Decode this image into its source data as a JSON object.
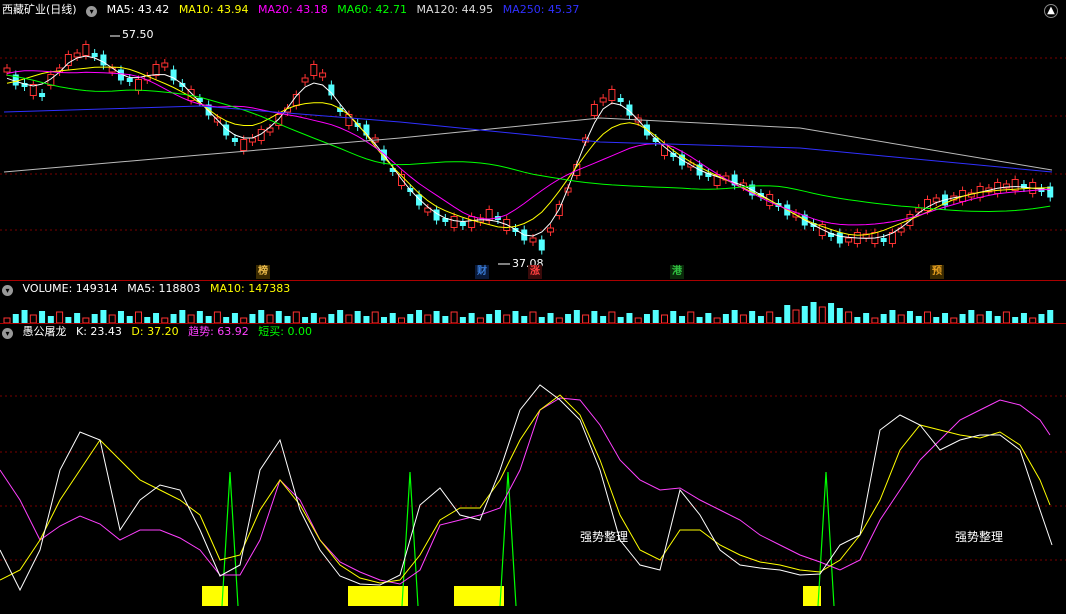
{
  "main": {
    "stock_name": "西藏矿业(日线)",
    "ma5_label": "MA5: 43.42",
    "ma10_label": "MA10: 43.94",
    "ma20_label": "MA20: 43.18",
    "ma60_label": "MA60: 42.71",
    "ma120_label": "MA120: 44.95",
    "ma250_label": "MA250: 45.37",
    "high_label": "57.50",
    "low_label": "37.08",
    "markers": [
      {
        "text": "榜",
        "color": "#e8b84a"
      },
      {
        "text": "财",
        "color": "#3a7bd5"
      },
      {
        "text": "涨",
        "color": "#ff4040"
      },
      {
        "text": "港",
        "color": "#30c040"
      },
      {
        "text": "预",
        "color": "#e8a020"
      }
    ]
  },
  "volume": {
    "label": "VOLUME: 149314",
    "ma5_label": "MA5: 118803",
    "ma10_label": "MA10: 147383"
  },
  "indicator": {
    "name": "愚公屠龙",
    "k_label": "K: 23.43",
    "d_label": "D: 37.20",
    "trend_label": "趋势: 63.92",
    "short_label": "短买: 0.00",
    "annotation_1": "强势整理",
    "annotation_2": "强势整理"
  },
  "colors": {
    "up": "#ff3232",
    "down": "#54ffff",
    "ma5": "#ffffff",
    "ma10": "#ffff00",
    "ma20": "#ff00ff",
    "ma60": "#00ff00",
    "ma120": "#ffffff",
    "ma250": "#3030ff"
  }
}
